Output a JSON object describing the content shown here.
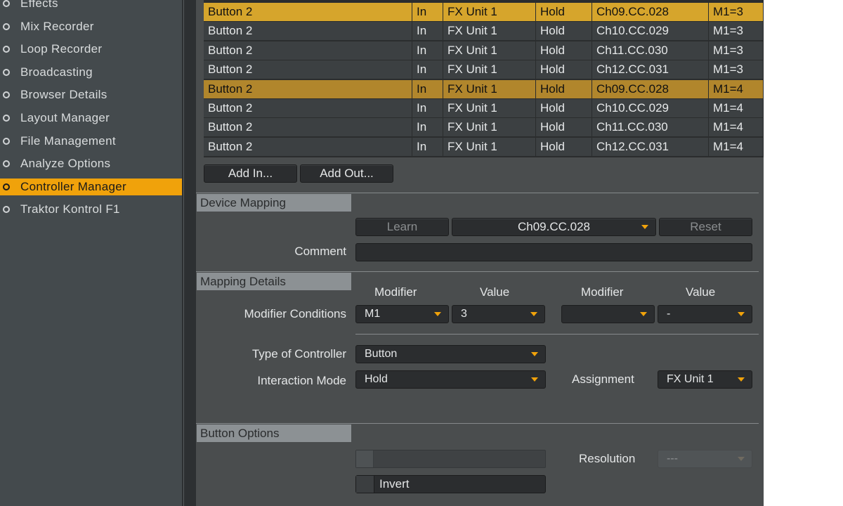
{
  "sidebar": {
    "items": [
      {
        "label": "Effects",
        "active": false
      },
      {
        "label": "Mix Recorder",
        "active": false
      },
      {
        "label": "Loop Recorder",
        "active": false
      },
      {
        "label": "Broadcasting",
        "active": false
      },
      {
        "label": "Browser Details",
        "active": false
      },
      {
        "label": "Layout Manager",
        "active": false
      },
      {
        "label": "File Management",
        "active": false
      },
      {
        "label": "Analyze Options",
        "active": false
      },
      {
        "label": "Controller Manager",
        "active": true
      },
      {
        "label": "Traktor Kontrol F1",
        "active": false
      }
    ]
  },
  "mapping_table": {
    "rows": [
      {
        "control": "Button 2",
        "io": "In",
        "assignment": "FX Unit 1",
        "mode": "Hold",
        "mapped_to": "Ch09.CC.028",
        "modifier": "M1=3",
        "state": "selected"
      },
      {
        "control": "Button 2",
        "io": "In",
        "assignment": "FX Unit 1",
        "mode": "Hold",
        "mapped_to": "Ch10.CC.029",
        "modifier": "M1=3",
        "state": "normal"
      },
      {
        "control": "Button 2",
        "io": "In",
        "assignment": "FX Unit 1",
        "mode": "Hold",
        "mapped_to": "Ch11.CC.030",
        "modifier": "M1=3",
        "state": "normal"
      },
      {
        "control": "Button 2",
        "io": "In",
        "assignment": "FX Unit 1",
        "mode": "Hold",
        "mapped_to": "Ch12.CC.031",
        "modifier": "M1=3",
        "state": "normal"
      },
      {
        "control": "Button 2",
        "io": "In",
        "assignment": "FX Unit 1",
        "mode": "Hold",
        "mapped_to": "Ch09.CC.028",
        "modifier": "M1=4",
        "state": "highlighted"
      },
      {
        "control": "Button 2",
        "io": "In",
        "assignment": "FX Unit 1",
        "mode": "Hold",
        "mapped_to": "Ch10.CC.029",
        "modifier": "M1=4",
        "state": "normal"
      },
      {
        "control": "Button 2",
        "io": "In",
        "assignment": "FX Unit 1",
        "mode": "Hold",
        "mapped_to": "Ch11.CC.030",
        "modifier": "M1=4",
        "state": "normal"
      },
      {
        "control": "Button 2",
        "io": "In",
        "assignment": "FX Unit 1",
        "mode": "Hold",
        "mapped_to": "Ch12.CC.031",
        "modifier": "M1=4",
        "state": "normal"
      }
    ],
    "add_in_label": "Add In...",
    "add_out_label": "Add Out..."
  },
  "device_mapping": {
    "title": "Device Mapping",
    "learn_label": "Learn",
    "mapped_value": "Ch09.CC.028",
    "reset_label": "Reset",
    "comment_label": "Comment",
    "comment_value": ""
  },
  "mapping_details": {
    "title": "Mapping Details",
    "modifier_header": "Modifier",
    "value_header": "Value",
    "modifier_header_2": "Modifier",
    "value_header_2": "Value",
    "conditions_label": "Modifier Conditions",
    "cond1_modifier": "M1",
    "cond1_value": "3",
    "cond2_modifier": "",
    "cond2_value": "-",
    "type_label": "Type of Controller",
    "type_value": "Button",
    "interaction_label": "Interaction Mode",
    "interaction_value": "Hold",
    "assignment_label": "Assignment",
    "assignment_value": "FX Unit 1"
  },
  "button_options": {
    "title": "Button Options",
    "resolution_label": "Resolution",
    "resolution_value": "---",
    "invert_label": "Invert"
  },
  "colors": {
    "accent": "#f0a20b",
    "selected_row": "#d6a52c",
    "highlighted_row": "#b1862c"
  }
}
